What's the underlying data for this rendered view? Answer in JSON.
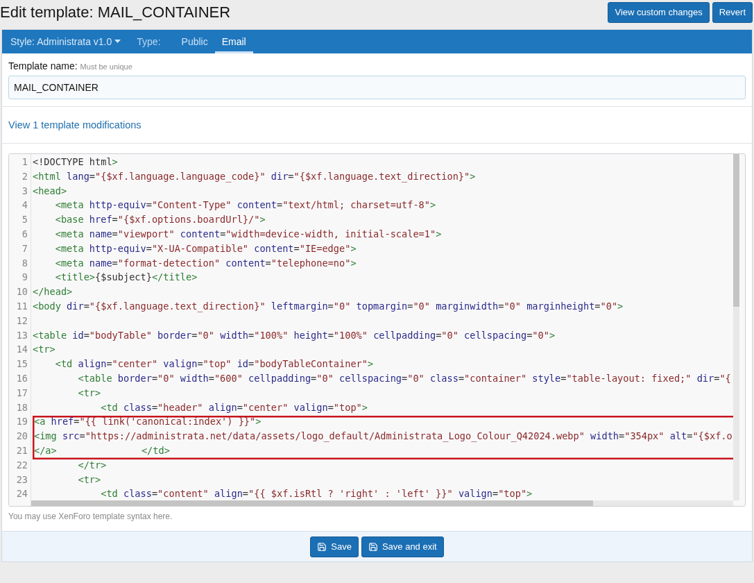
{
  "page_title": "Edit template: MAIL_CONTAINER",
  "header_buttons": [
    "View custom changes",
    "Revert"
  ],
  "style_selector": {
    "label": "Style: Administrata v1.0"
  },
  "type_label": "Type:",
  "tabs": [
    {
      "label": "Public",
      "selected": false
    },
    {
      "label": "Email",
      "selected": true
    }
  ],
  "template_name": {
    "label": "Template name:",
    "hint": "Must be unique",
    "value": "MAIL_CONTAINER"
  },
  "modifications_link": "View 1 template modifications",
  "editor": {
    "lines": [
      {
        "number": "1",
        "code": "<!DOCTYPE html>",
        "highlighted": false
      },
      {
        "number": "2",
        "code": "<html lang=\"{$xf.language.language_code}\" dir=\"{$xf.language.text_direction}\">",
        "highlighted": false
      },
      {
        "number": "3",
        "code": "<head>",
        "highlighted": false
      },
      {
        "number": "4",
        "code": "    <meta http-equiv=\"Content-Type\" content=\"text/html; charset=utf-8\">",
        "highlighted": false
      },
      {
        "number": "5",
        "code": "    <base href=\"{$xf.options.boardUrl}/\">",
        "highlighted": false
      },
      {
        "number": "6",
        "code": "    <meta name=\"viewport\" content=\"width=device-width, initial-scale=1\">",
        "highlighted": false
      },
      {
        "number": "7",
        "code": "    <meta http-equiv=\"X-UA-Compatible\" content=\"IE=edge\">",
        "highlighted": false
      },
      {
        "number": "8",
        "code": "    <meta name=\"format-detection\" content=\"telephone=no\">",
        "highlighted": false
      },
      {
        "number": "9",
        "code": "    <title>{$subject}</title>",
        "highlighted": false
      },
      {
        "number": "10",
        "code": "</head>",
        "highlighted": false
      },
      {
        "number": "11",
        "code": "<body dir=\"{$xf.language.text_direction}\" leftmargin=\"0\" topmargin=\"0\" marginwidth=\"0\" marginheight=\"0\">",
        "highlighted": false
      },
      {
        "number": "12",
        "highlighted": false
      },
      {
        "number": "13",
        "code": "<table id=\"bodyTable\" border=\"0\" width=\"100%\" height=\"100%\" cellpadding=\"0\" cellspacing=\"0\">",
        "highlighted": false
      },
      {
        "number": "14",
        "code": "<tr>",
        "highlighted": false
      },
      {
        "number": "15",
        "code": "    <td align=\"center\" valign=\"top\" id=\"bodyTableContainer\">",
        "highlighted": false
      },
      {
        "number": "16",
        "code": "        <table border=\"0\" width=\"600\" cellpadding=\"0\" cellspacing=\"0\" class=\"container\" style=\"table-layout: fixed;\" dir=\"{",
        "highlighted": false
      },
      {
        "number": "17",
        "code": "        <tr>",
        "highlighted": false
      },
      {
        "number": "18",
        "code": "            <td class=\"header\" align=\"center\" valign=\"top\">",
        "highlighted": false
      },
      {
        "number": "19",
        "code": "<a href=\"{{ link('canonical:index') }}\">",
        "highlighted": true
      },
      {
        "number": "20",
        "code": "<img src=\"https://administrata.net/data/assets/logo_default/Administrata_Logo_Colour_Q42024.webp\" width=\"354px\" alt=\"{$xf.o",
        "highlighted": true
      },
      {
        "number": "21",
        "code": "</a>",
        "code_2": "</td>",
        "highlighted": true
      },
      {
        "number": "22",
        "code": "        </tr>",
        "highlighted": false
      },
      {
        "number": "23",
        "code": "        <tr>",
        "highlighted": false
      },
      {
        "number": "24",
        "code": "            <td class=\"content\" align=\"{{ $xf.isRtl ? 'right' : 'left' }}\" valign=\"top\">",
        "highlighted": false
      }
    ]
  },
  "editor_hint": "You may use XenForo template syntax here.",
  "footer_buttons": [
    "Save",
    "Save and exit"
  ]
}
